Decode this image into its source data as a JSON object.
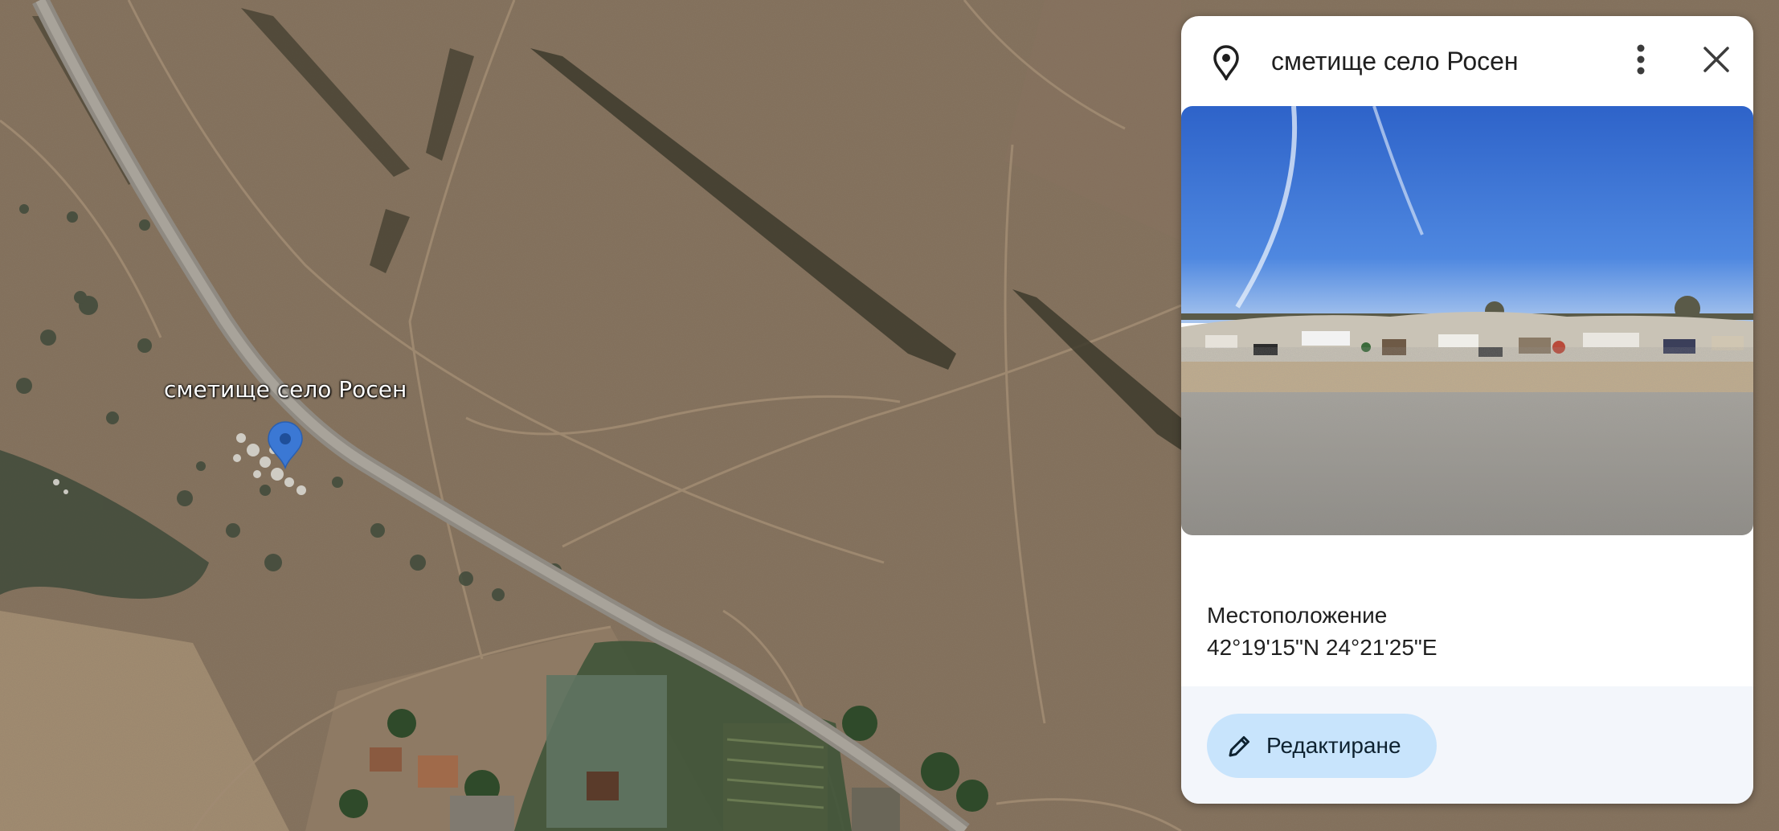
{
  "map": {
    "place_label": "сметище село Росен"
  },
  "panel": {
    "title": "сметище село Росен",
    "location_label": "Местоположение",
    "coordinates": "42°19'15\"N 24°21'25\"E",
    "edit_label": "Редактиране"
  },
  "icons": {
    "header": "location-pin-icon",
    "more": "more-vert-icon",
    "close": "close-icon",
    "edit": "pencil-icon",
    "map_marker": "map-marker-icon"
  },
  "colors": {
    "marker": "#3b78d4",
    "edit_button_bg": "#c8e4fc",
    "footer_bg": "#f3f6fb"
  }
}
